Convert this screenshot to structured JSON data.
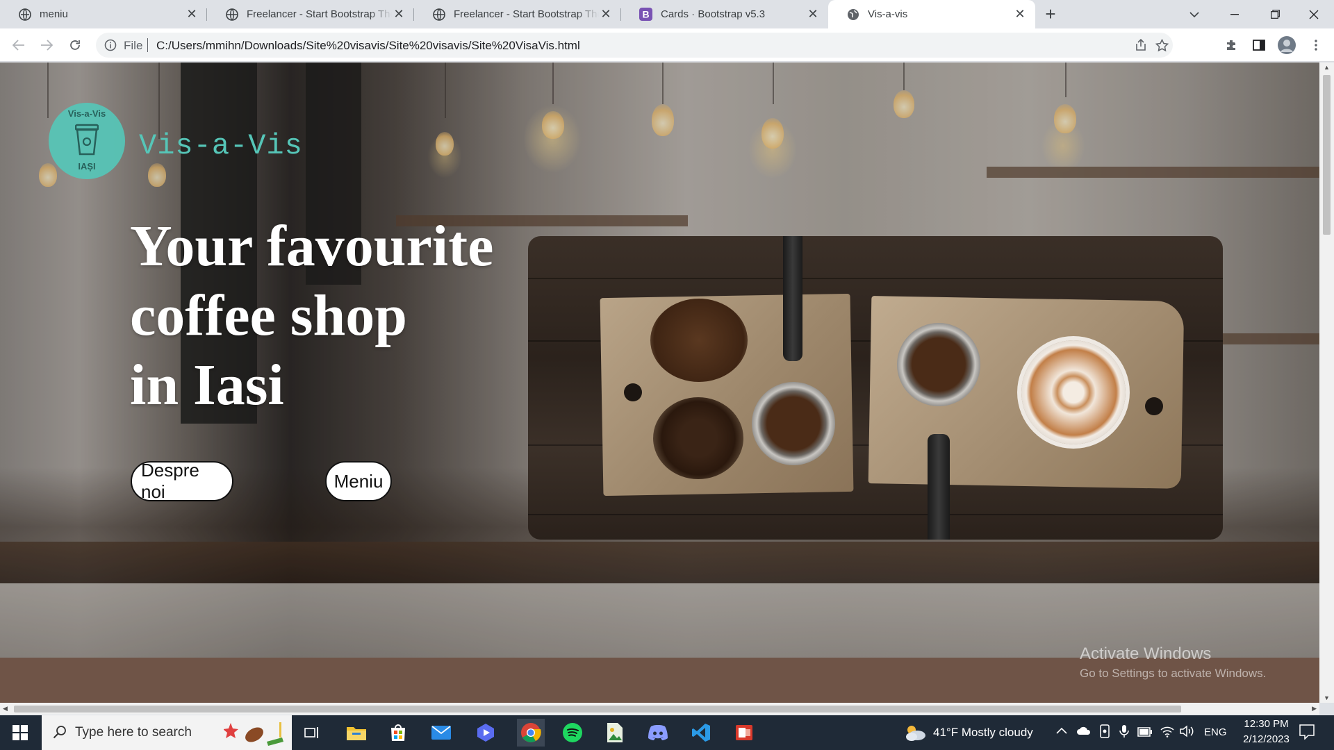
{
  "browser": {
    "tabs": [
      {
        "title": "meniu",
        "active": false,
        "icon": "globe-icon"
      },
      {
        "title": "Freelancer - Start Bootstrap Them",
        "active": false,
        "icon": "globe-icon"
      },
      {
        "title": "Freelancer - Start Bootstrap Them",
        "active": false,
        "icon": "globe-icon"
      },
      {
        "title": "Cards · Bootstrap v5.3",
        "active": false,
        "icon": "bootstrap-icon"
      },
      {
        "title": "Vis-a-vis",
        "active": true,
        "icon": "globe-icon"
      }
    ],
    "address": {
      "scheme_label": "File",
      "url": "C:/Users/mmihn/Downloads/Site%20visavis/Site%20visavis/Site%20VisaVis.html"
    }
  },
  "page": {
    "logo": {
      "ring_top": "Vis-a-Vis",
      "ring_bottom": "IAȘI",
      "icon": "coffee-cup-icon"
    },
    "brand_name": "Vis-a-Vis",
    "headline": {
      "line1": "Your favourite",
      "line2": "coffee shop",
      "line3": "in Iasi"
    },
    "buttons": {
      "about": "Despre noi",
      "menu": "Meniu"
    },
    "colors": {
      "brand_teal": "#56c6b8",
      "footer_band": "#6f5447"
    }
  },
  "watermark": {
    "title": "Activate Windows",
    "subtitle": "Go to Settings to activate Windows."
  },
  "taskbar": {
    "search_placeholder": "Type here to search",
    "weather": "41°F  Mostly cloudy",
    "language": "ENG",
    "time": "12:30 PM",
    "date": "2/12/2023"
  }
}
